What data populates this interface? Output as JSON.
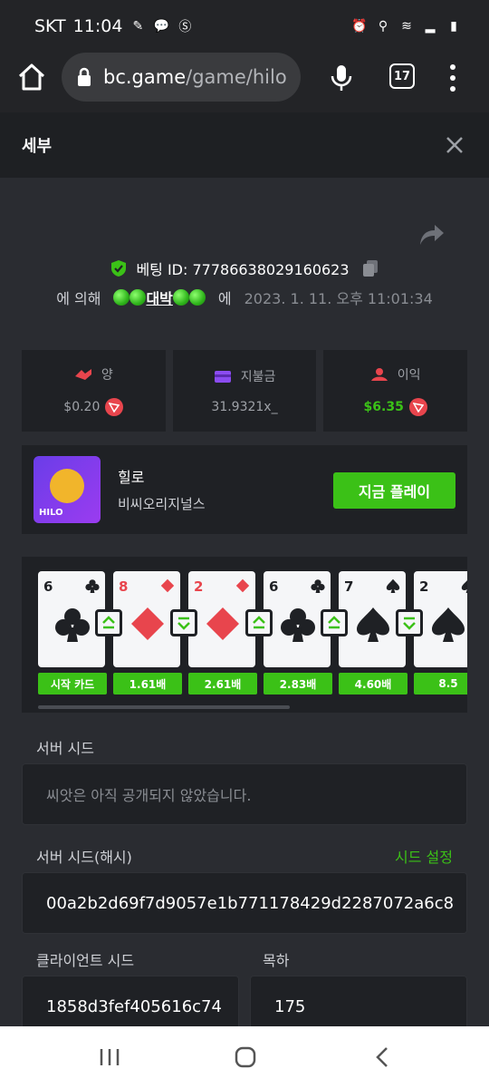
{
  "status": {
    "carrier": "SKT",
    "time": "11:04"
  },
  "browser": {
    "domain": "bc.game",
    "path": "/game/hilo",
    "tab_count": "17"
  },
  "header": {
    "title": "세부"
  },
  "bet": {
    "id_label": "베팅 ID: 77786638029160623",
    "by_prefix": "에 의해",
    "username": "대박",
    "on_word": "에",
    "timestamp": "2023. 1. 11. 오후 11:01:34"
  },
  "stats": [
    {
      "label": "양",
      "value": "$0.20",
      "icon": "bet-icon",
      "color": "#e8454d"
    },
    {
      "label": "지불금",
      "value": "31.9321x_",
      "icon": "wallet-icon",
      "color": "#8b4cf0"
    },
    {
      "label": "이익",
      "value": "$6.35",
      "icon": "profit-icon",
      "color": "#e8454d"
    }
  ],
  "game": {
    "name": "힐로",
    "provider": "비씨오리지널스",
    "play_label": "지금 플레이",
    "thumb_label": "HILO"
  },
  "cards": [
    {
      "rank": "6",
      "suit": "club",
      "mult": "시작 카드",
      "arrow": ""
    },
    {
      "rank": "8",
      "suit": "diamond",
      "mult": "1.61배",
      "arrow": "up"
    },
    {
      "rank": "2",
      "suit": "diamond",
      "mult": "2.61배",
      "arrow": "down"
    },
    {
      "rank": "6",
      "suit": "club",
      "mult": "2.83배",
      "arrow": "up"
    },
    {
      "rank": "7",
      "suit": "spade",
      "mult": "4.60배",
      "arrow": "up"
    },
    {
      "rank": "2",
      "suit": "spade",
      "mult": "8.5",
      "arrow": "down"
    }
  ],
  "seeds": {
    "server_label": "서버 시드",
    "server_value": "씨앗은 아직 공개되지 않았습니다.",
    "hash_label": "서버 시드(해시)",
    "set_seed": "시드 설정",
    "hash_value": "00a2b2d69f7d9057e1b771178429d2287072a6c8",
    "client_label": "클라이언트 시드",
    "client_value": "1858d3fef405616c74",
    "nonce_label": "목하",
    "nonce_value": "175"
  },
  "colors": {
    "accent": "#3bc117",
    "bg": "#17181b",
    "panel": "#1f2125"
  }
}
